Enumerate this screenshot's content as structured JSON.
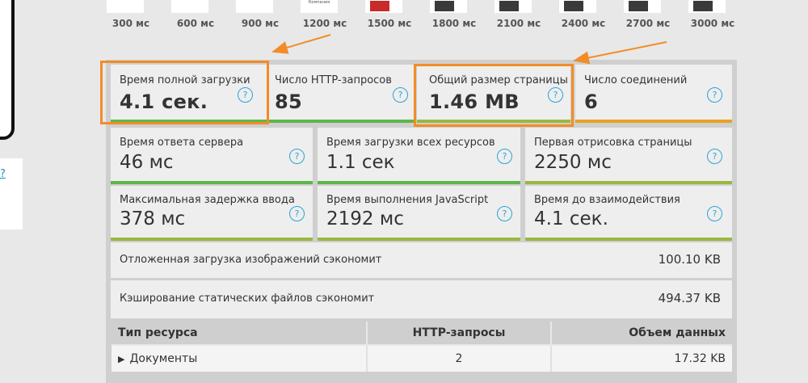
{
  "colors": {
    "accent_blue": "#29a3d5",
    "highlight_orange": "#f28c28",
    "bar_green": "#5cb74a",
    "bar_olive": "#99b83f",
    "bar_orange": "#e7a323"
  },
  "left_panel": {
    "link_text": "?"
  },
  "filmstrip": {
    "frames": [
      {
        "label": "300 мс"
      },
      {
        "label": "600 мс"
      },
      {
        "label": "900 мс"
      },
      {
        "label": "1200 мс",
        "mini": "Компания"
      },
      {
        "label": "1500 мс"
      },
      {
        "label": "1800 мс"
      },
      {
        "label": "2100 мс"
      },
      {
        "label": "2400 мс"
      },
      {
        "label": "2700 мс"
      },
      {
        "label": "3000 мс"
      }
    ]
  },
  "summary": [
    {
      "label": "Время полной загрузки",
      "value": "4.1 сек.",
      "bar": "green",
      "highlighted": true
    },
    {
      "label": "Число HTTP-запросов",
      "value": "85",
      "bar": "green",
      "highlighted": false
    },
    {
      "label": "Общий размер страницы",
      "value": "1.46 MB",
      "bar": "olive",
      "highlighted": true
    },
    {
      "label": "Число соединений",
      "value": "6",
      "bar": "orange",
      "highlighted": false
    }
  ],
  "metrics": [
    {
      "label": "Время ответа сервера",
      "value": "46 мс",
      "bar": "green"
    },
    {
      "label": "Время загрузки всех ресурсов",
      "value": "1.1 сек",
      "bar": "green"
    },
    {
      "label": "Первая отрисовка страницы",
      "value": "2250 мс",
      "bar": "olive"
    },
    {
      "label": "Максимальная задержка ввода",
      "value": "378 мс",
      "bar": "olive"
    },
    {
      "label": "Время выполнения JavaScript",
      "value": "2192 мс",
      "bar": "olive"
    },
    {
      "label": "Время до взаимодействия",
      "value": "4.1 сек.",
      "bar": "olive"
    }
  ],
  "savings": [
    {
      "label": "Отложенная загрузка изображений сэкономит",
      "value": "100.10 KB"
    },
    {
      "label": "Кэширование статических файлов сэкономит",
      "value": "494.37 KB"
    }
  ],
  "help_glyph": "?",
  "resource_table": {
    "headers": [
      "Тип ресурса",
      "HTTP-запросы",
      "Объем данных"
    ],
    "rows": [
      {
        "expander": "▶",
        "type": "Документы",
        "requests": "2",
        "size": "17.32 KB"
      }
    ]
  }
}
